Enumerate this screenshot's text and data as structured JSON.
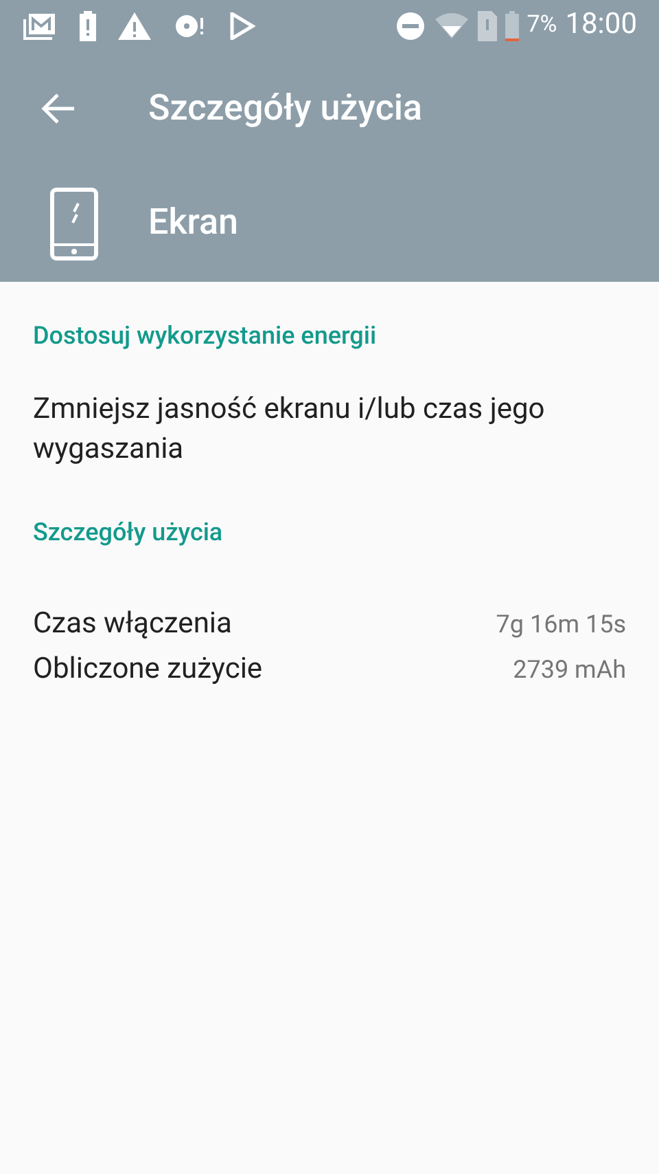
{
  "status_bar": {
    "battery_text": "7%",
    "time": "18:00"
  },
  "app_bar": {
    "title": "Szczegóły użycia"
  },
  "header": {
    "title": "Ekran"
  },
  "sections": [
    {
      "title": "Dostosuj wykorzystanie energii",
      "kind": "text",
      "text": "Zmniejsz jasność ekranu i/lub czas jego wygaszania"
    },
    {
      "title": "Szczegóły użycia",
      "kind": "rows",
      "rows": [
        {
          "label": "Czas włączenia",
          "value": "7g 16m 15s"
        },
        {
          "label": "Obliczone zużycie",
          "value": "2739 mAh"
        }
      ]
    }
  ]
}
